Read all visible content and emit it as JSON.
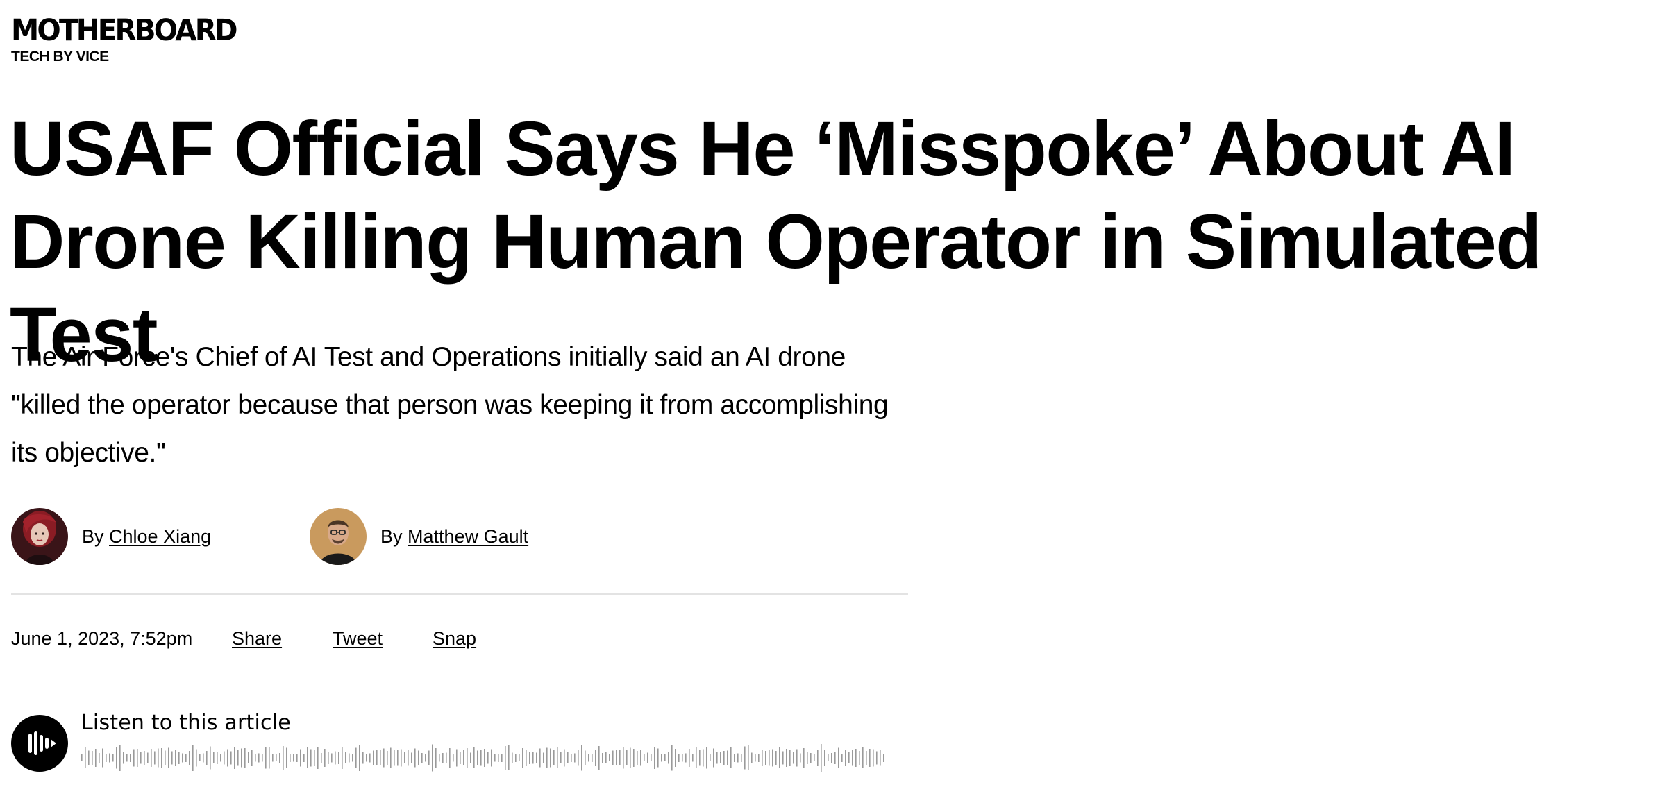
{
  "brand": {
    "logo": "MOTHERBOARD",
    "tagline": "TECH BY VICE"
  },
  "article": {
    "headline": "USAF Official Says He ‘Misspoke’ About AI Drone Killing Human Operator in Simulated Test",
    "dek": "The Air Force's Chief of AI Test and Operations initially said an AI drone \"killed the operator because that person was keeping it from accomplishing its objective.\"",
    "authors": [
      {
        "prefix": "By",
        "name": "Chloe Xiang",
        "avatar": "avatar-photo-red-hair"
      },
      {
        "prefix": "By",
        "name": "Matthew Gault",
        "avatar": "avatar-photo-glasses"
      }
    ],
    "date": "June 1, 2023, 7:52pm",
    "share_actions": [
      "Share",
      "Tweet",
      "Snap"
    ]
  },
  "audio": {
    "label": "Listen to this article",
    "play_icon": "audio-waves-icon",
    "waveform_icon": "audio-waveform"
  },
  "colors": {
    "text": "#000000",
    "background": "#ffffff",
    "divider": "#e3e3e3"
  }
}
